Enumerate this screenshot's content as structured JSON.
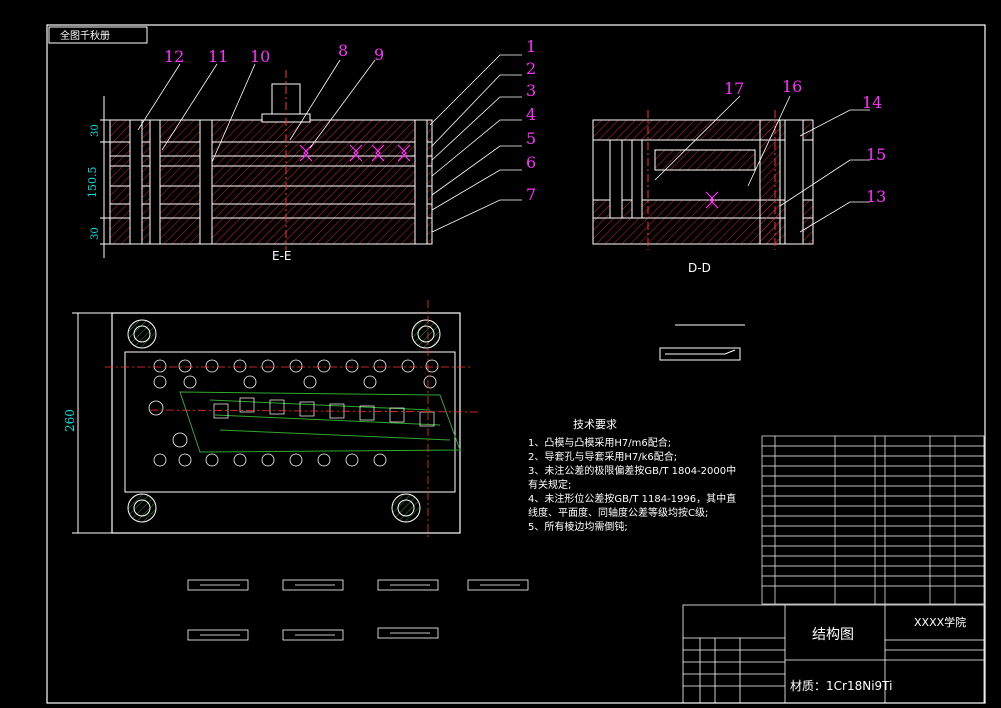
{
  "drawing": {
    "title_box": "全图千秋册",
    "section_ee": "E-E",
    "section_dd": "D-D",
    "dim_150": "150.5",
    "dim_30_top": "30",
    "dim_30_bottom": "30",
    "dim_260": "260",
    "callouts": [
      "1",
      "2",
      "3",
      "4",
      "5",
      "6",
      "7",
      "8",
      "9",
      "10",
      "11",
      "12",
      "13",
      "14",
      "15",
      "16",
      "17"
    ]
  },
  "tech_req": {
    "title": "技术要求",
    "lines": [
      "1、凸模与凸模采用H7/m6配合;",
      "2、导套孔与导套采用H7/k6配合;",
      "3、未注公差的极限偏差按GB/T 1804-2000中",
      "   有关规定;",
      "4、未注形位公差按GB/T 1184-1996，其中直",
      "   线度、平面度、同轴度公差等级均按C级;",
      "5、所有棱边均需倒钝;"
    ]
  },
  "title_block": {
    "drawing_name": "结构图",
    "school": "XXXX学院",
    "material": "材质：1Cr18Ni9Ti"
  }
}
